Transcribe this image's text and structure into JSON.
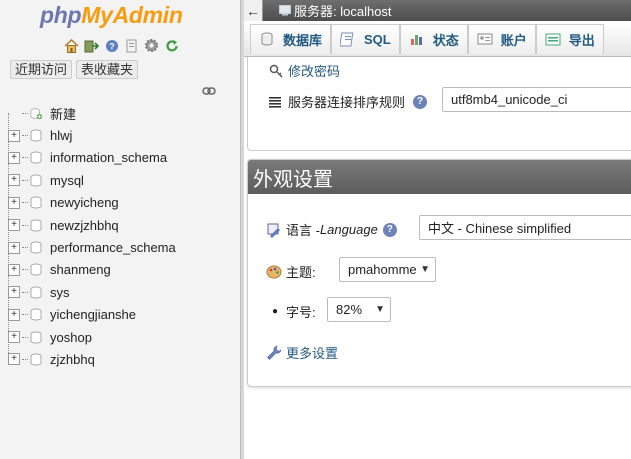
{
  "nav": {
    "logo_php": "php",
    "logo_myadmin": "MyAdmin",
    "icons": [
      "home-icon",
      "exit-icon",
      "help-icon",
      "docs-icon",
      "settings-icon",
      "reload-icon"
    ],
    "tabs": [
      "近期访问",
      "表收藏夹"
    ],
    "tree": [
      {
        "label": "新建",
        "expander": false
      },
      {
        "label": "hlwj",
        "expander": true
      },
      {
        "label": "information_schema",
        "expander": true
      },
      {
        "label": "mysql",
        "expander": true
      },
      {
        "label": "newyicheng",
        "expander": true
      },
      {
        "label": "newzjzhbhq",
        "expander": true
      },
      {
        "label": "performance_schema",
        "expander": true
      },
      {
        "label": "shanmeng",
        "expander": true
      },
      {
        "label": "sys",
        "expander": true
      },
      {
        "label": "yichengjianshe",
        "expander": true
      },
      {
        "label": "yoshop",
        "expander": true
      },
      {
        "label": "zjzhbhq",
        "expander": true
      }
    ]
  },
  "breadcrumb": {
    "back": "←",
    "server": "服务器: localhost"
  },
  "menu": {
    "tabs": [
      {
        "label": "数据库",
        "icon": "database-icon"
      },
      {
        "label": "SQL",
        "icon": "sql-icon"
      },
      {
        "label": "状态",
        "icon": "status-icon"
      },
      {
        "label": "账户",
        "icon": "accounts-icon"
      },
      {
        "label": "导出",
        "icon": "export-icon"
      }
    ]
  },
  "general_settings": {
    "change_password": "修改密码",
    "collation_label": "服务器连接排序规则",
    "collation_value": "utf8mb4_unicode_ci"
  },
  "appearance": {
    "title": "外观设置",
    "language_label": "语言 - ",
    "language_label_en": "Language",
    "language_value": "中文 - Chinese simplified",
    "theme_label": "主题:",
    "theme_value": "pmahomme",
    "fontsize_label": "字号:",
    "fontsize_value": "82%",
    "more_settings": "更多设置"
  },
  "colors": {
    "logo_php": "#6c78af",
    "logo_myadmin": "#f89c0e",
    "link": "#235a81",
    "header_bar": "#5c5c5c"
  }
}
